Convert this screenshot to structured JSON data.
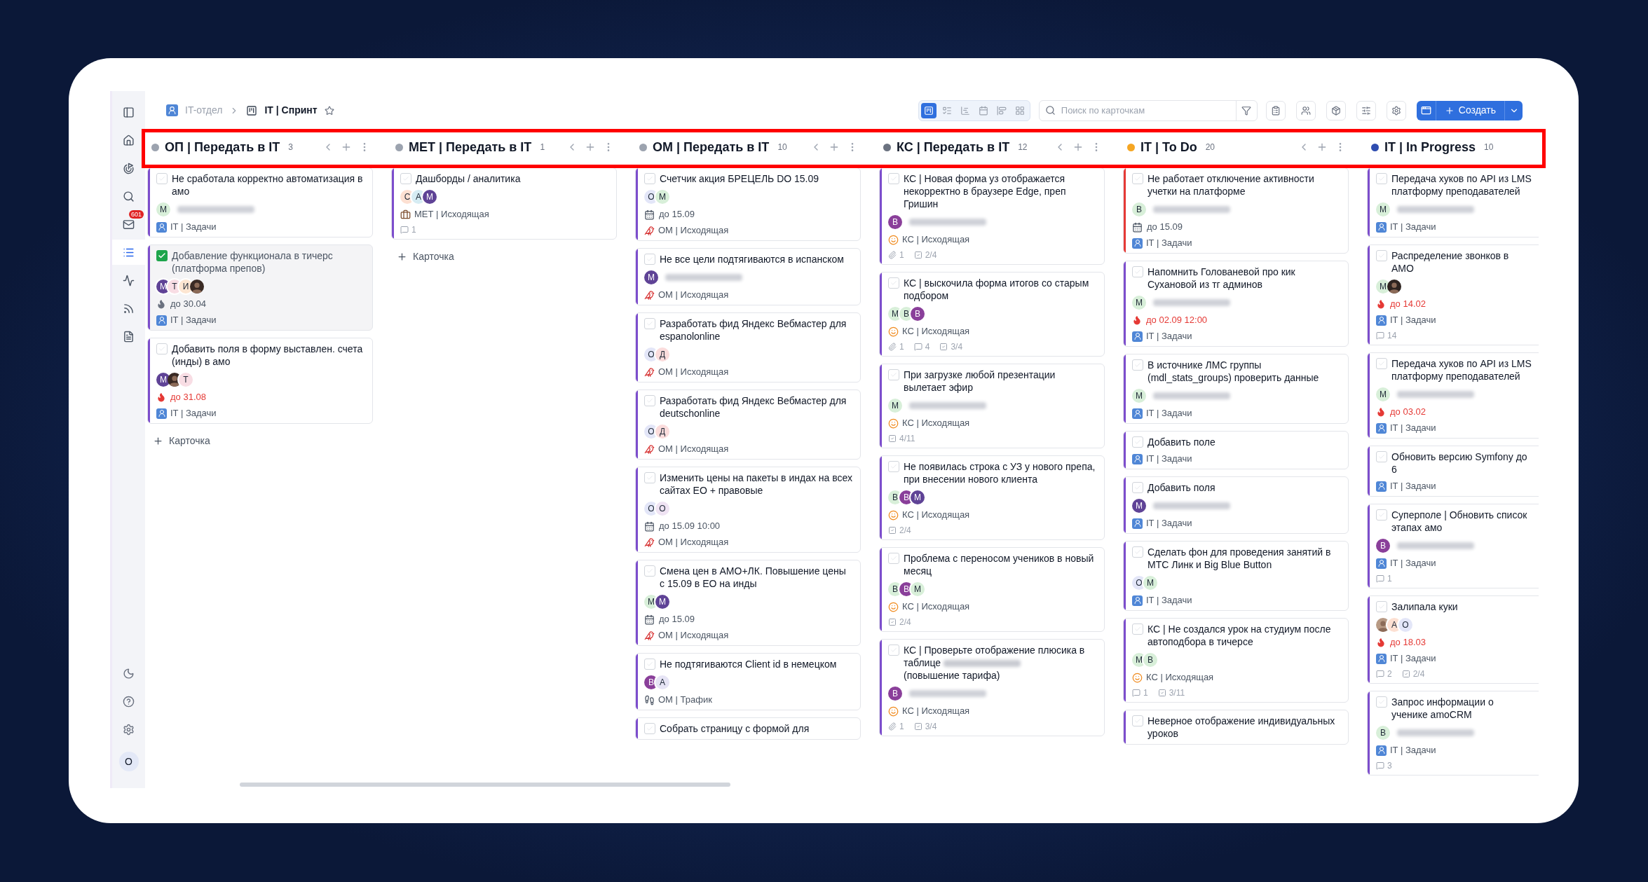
{
  "sidebar": {
    "items": [
      {
        "kind": "panel",
        "selected": false
      },
      {
        "kind": "home",
        "selected": false
      },
      {
        "kind": "goal",
        "selected": false
      },
      {
        "kind": "search",
        "selected": false
      },
      {
        "kind": "mail",
        "selected": false,
        "badge": "601"
      },
      {
        "kind": "list",
        "selected": true
      },
      {
        "kind": "activity",
        "selected": false
      },
      {
        "kind": "feed",
        "selected": false
      },
      {
        "kind": "document",
        "selected": false
      }
    ],
    "bottom": [
      {
        "kind": "theme"
      },
      {
        "kind": "help"
      },
      {
        "kind": "settings"
      }
    ],
    "user": {
      "letter": "О"
    }
  },
  "breadcrumb": {
    "parent": "IT-отдел",
    "current": "IT | Спринт",
    "starred": false
  },
  "views": [
    {
      "kind": "board",
      "selected": true
    },
    {
      "kind": "list",
      "selected": false
    },
    {
      "kind": "gantt",
      "selected": false
    },
    {
      "kind": "calendar",
      "selected": false
    },
    {
      "kind": "timeline",
      "selected": false
    },
    {
      "kind": "grid",
      "selected": false
    }
  ],
  "search": {
    "placeholder": "Поиск по карточкам"
  },
  "tools": [
    {
      "kind": "clipboard"
    },
    {
      "kind": "users"
    },
    {
      "kind": "bag"
    },
    {
      "kind": "sliders"
    },
    {
      "kind": "settings"
    }
  ],
  "create_button": {
    "label": "Создать"
  },
  "columns": [
    {
      "title": "ОП | Передать в IT",
      "count": "3",
      "color": "#9ca3af",
      "controls": true,
      "add_label": "Карточка",
      "cards": [
        {
          "title": "Не сработала корректно автоматизация в амо",
          "done": false,
          "color": "#7c4dcc",
          "avatars": [
            {
              "letter": "М",
              "color": "#d8efd9"
            }
          ],
          "name_hidden": true,
          "project": {
            "kind": "it",
            "text": "IT | Задачи"
          }
        },
        {
          "title": "Добавление функционала в тичерс (платформа препов)",
          "done": true,
          "color": "#7c4dcc",
          "avatars": [
            {
              "letter": "М",
              "color": "#5f4396"
            },
            {
              "letter": "Т",
              "color": "#f8dde4"
            },
            {
              "letter": "И",
              "color": "#fde6d2"
            },
            {
              "kind": "photo",
              "color": "#3a2a24"
            }
          ],
          "due": {
            "kind": "flame",
            "text": "до 30.04",
            "overdue": false
          },
          "project": {
            "kind": "it",
            "text": "IT | Задачи"
          }
        },
        {
          "title": "Добавить поля в форму выставлен. счета (инды) в амо",
          "done": false,
          "color": "#7c4dcc",
          "avatars": [
            {
              "letter": "М",
              "color": "#5f4396"
            },
            {
              "kind": "photo",
              "color": "#3a2a24"
            },
            {
              "letter": "Т",
              "color": "#f8dde4"
            }
          ],
          "due": {
            "kind": "flame",
            "text": "до 31.08",
            "overdue": true
          },
          "project": {
            "kind": "it",
            "text": "IT | Задачи"
          }
        }
      ]
    },
    {
      "title": "МЕТ | Передать в IT",
      "count": "1",
      "color": "#9ca3af",
      "controls": true,
      "add_label": "Карточка",
      "cards": [
        {
          "title": "Дашборды / аналитика",
          "done": false,
          "color": "#7c4dcc",
          "avatars": [
            {
              "letter": "С",
              "color": "#fde0d2"
            },
            {
              "letter": "А",
              "color": "#d6ecf3"
            },
            {
              "letter": "М",
              "color": "#5f4396"
            }
          ],
          "project": {
            "kind": "met",
            "text": "МЕТ | Исходящая"
          },
          "comments": "1"
        }
      ]
    },
    {
      "title": "ОМ | Передать в IT",
      "count": "10",
      "color": "#9ca3af",
      "controls": true,
      "cards": [
        {
          "title": "Счетчик акция БРЕЦЕЛЬ DO 15.09",
          "done": false,
          "color": "#7c4dcc",
          "avatars": [
            {
              "letter": "О",
              "color": "#e3e6f8"
            },
            {
              "letter": "М",
              "color": "#d8efd9"
            }
          ],
          "due": {
            "kind": "calendar",
            "text": "до 15.09",
            "overdue": false
          },
          "project": {
            "kind": "om",
            "text": "ОМ | Исходящая"
          }
        },
        {
          "title": "Не все цели подтягиваются в испанском",
          "done": false,
          "color": "#7c4dcc",
          "avatars": [
            {
              "letter": "М",
              "color": "#5f4396"
            }
          ],
          "name_hidden": true,
          "project": {
            "kind": "om",
            "text": "ОМ | Исходящая"
          }
        },
        {
          "title": "Разработать фид Яндекс Вебмастер для espanolonline",
          "done": false,
          "color": "#7c4dcc",
          "avatars": [
            {
              "letter": "О",
              "color": "#e3e6f8"
            },
            {
              "letter": "Д",
              "color": "#fbdcdc"
            }
          ],
          "project": {
            "kind": "om",
            "text": "ОМ | Исходящая"
          }
        },
        {
          "title": "Разработать фид Яндекс Вебмастер для deutschonline",
          "done": false,
          "color": "#7c4dcc",
          "avatars": [
            {
              "letter": "О",
              "color": "#e3e6f8"
            },
            {
              "letter": "Д",
              "color": "#fbdcdc"
            }
          ],
          "project": {
            "kind": "om",
            "text": "ОМ | Исходящая"
          }
        },
        {
          "title": "Изменить цены на пакеты в индах на всех сайтах ЕО + правовые",
          "done": false,
          "color": "#7c4dcc",
          "avatars": [
            {
              "letter": "О",
              "color": "#e3e6f8"
            },
            {
              "letter": "О",
              "color": "#efe3f3"
            }
          ],
          "due": {
            "kind": "calendar",
            "text": "до 15.09 10:00",
            "overdue": false
          },
          "project": {
            "kind": "om",
            "text": "ОМ | Исходящая"
          }
        },
        {
          "title": "Смена цен в АМО+ЛК. Повышение цены с 15.09 в ЕО на инды",
          "done": false,
          "color": "#7c4dcc",
          "avatars": [
            {
              "letter": "М",
              "color": "#d8efd9"
            },
            {
              "letter": "М",
              "color": "#5f4396"
            }
          ],
          "due": {
            "kind": "calendar",
            "text": "до 15.09",
            "overdue": false
          },
          "project": {
            "kind": "om",
            "text": "ОМ | Исходящая"
          }
        },
        {
          "title": "Не подтягиваются Client id в немецком",
          "done": false,
          "color": "#7c4dcc",
          "avatars": [
            {
              "letter": "В",
              "color": "#8a3f9a"
            },
            {
              "letter": "А",
              "color": "#e6e4f5"
            }
          ],
          "project": {
            "kind": "traffic",
            "text": "ОМ | Трафик"
          }
        },
        {
          "title": "Собрать страницу с формой для",
          "done": false,
          "color": "#7c4dcc"
        }
      ]
    },
    {
      "title": "КС | Передать в IT",
      "count": "12",
      "color": "#6b7280",
      "controls": true,
      "cards": [
        {
          "title": "КС | Новая форма уз отображается некорректно в браузере Edge, преп Гришин",
          "done": false,
          "color": "#7c4dcc",
          "avatars": [
            {
              "letter": "В",
              "color": "#8a3f9a"
            }
          ],
          "name_hidden": true,
          "project": {
            "kind": "kc",
            "text": "КС | Исходящая"
          },
          "attachments": "1",
          "checklist": "2/4"
        },
        {
          "title": "КС | выскочила форма итогов со старым подбором",
          "done": false,
          "color": "#7c4dcc",
          "avatars": [
            {
              "letter": "М",
              "color": "#d8efd9"
            },
            {
              "letter": "В",
              "color": "#d8efd9"
            },
            {
              "letter": "В",
              "color": "#8a3f9a"
            }
          ],
          "project": {
            "kind": "kc",
            "text": "КС | Исходящая"
          },
          "attachments": "1",
          "comments": "4",
          "checklist": "3/4"
        },
        {
          "title": "При загрузке любой презентации вылетает эфир",
          "done": false,
          "color": "#7c4dcc",
          "avatars": [
            {
              "letter": "М",
              "color": "#d8efd9"
            }
          ],
          "name_hidden": true,
          "project": {
            "kind": "kc",
            "text": "КС | Исходящая"
          },
          "checklist": "4/11"
        },
        {
          "title": "Не появилась строка с УЗ у нового препа, при внесении нового клиента",
          "done": false,
          "color": "#7c4dcc",
          "avatars": [
            {
              "letter": "В",
              "color": "#d8efd9"
            },
            {
              "letter": "В",
              "color": "#8a3f9a"
            },
            {
              "letter": "М",
              "color": "#5f4396"
            }
          ],
          "project": {
            "kind": "kc",
            "text": "КС | Исходящая"
          },
          "checklist": "2/4"
        },
        {
          "title": "Проблема с переносом учеников в новый месяц",
          "done": false,
          "color": "#7c4dcc",
          "avatars": [
            {
              "letter": "В",
              "color": "#d8efd9"
            },
            {
              "letter": "В",
              "color": "#8a3f9a"
            },
            {
              "letter": "М",
              "color": "#d8efd9"
            }
          ],
          "project": {
            "kind": "kc",
            "text": "КС | Исходящая"
          },
          "checklist": "2/4"
        },
        {
          "title": "КС | Проверьте отображение плюсика в таблице",
          "title_hidden_part": true,
          "title_rest": "(повышение тарифа)",
          "done": false,
          "color": "#7c4dcc",
          "avatars": [
            {
              "letter": "В",
              "color": "#8a3f9a"
            }
          ],
          "name_hidden": true,
          "project": {
            "kind": "kc",
            "text": "КС | Исходящая"
          },
          "attachments": "1",
          "checklist": "3/4"
        }
      ]
    },
    {
      "title": "IT | To Do",
      "count": "20",
      "color": "#f5a623",
      "controls": true,
      "cards": [
        {
          "title": "Не работает отключение активности учетки на платформе",
          "done": false,
          "color": "#e53935",
          "avatars": [
            {
              "letter": "В",
              "color": "#d8efd9"
            }
          ],
          "name_hidden": true,
          "due": {
            "kind": "calendar",
            "text": "до 15.09",
            "overdue": false
          },
          "project": {
            "kind": "it",
            "text": "IT | Задачи"
          }
        },
        {
          "title": "Напомнить Голованевой про кик Сухановой из тг админов",
          "done": false,
          "color": "#7c4dcc",
          "avatars": [
            {
              "letter": "М",
              "color": "#d8efd9"
            }
          ],
          "name_hidden": true,
          "due": {
            "kind": "flame",
            "text": "до 02.09 12:00",
            "overdue": true
          },
          "project": {
            "kind": "it",
            "text": "IT | Задачи"
          }
        },
        {
          "title": "В источнике ЛМС группы (mdl_stats_groups) проверить данные",
          "done": false,
          "color": "#7c4dcc",
          "avatars": [
            {
              "letter": "М",
              "color": "#d8efd9"
            }
          ],
          "name_hidden": true,
          "project": {
            "kind": "it",
            "text": "IT | Задачи"
          }
        },
        {
          "title": "Добавить поле",
          "done": false,
          "color": "#7c4dcc",
          "project": {
            "kind": "it",
            "text": "IT | Задачи"
          }
        },
        {
          "title": "Добавить поля",
          "done": false,
          "color": "#7c4dcc",
          "avatars": [
            {
              "letter": "М",
              "color": "#5f4396"
            }
          ],
          "name_hidden": true,
          "project": {
            "kind": "it",
            "text": "IT | Задачи"
          }
        },
        {
          "title": "Сделать фон для проведения занятий в МТС Линк и Big Blue Button",
          "done": false,
          "color": "#7c4dcc",
          "avatars": [
            {
              "letter": "О",
              "color": "#e3e6f8"
            },
            {
              "letter": "М",
              "color": "#d8efd9"
            }
          ],
          "project": {
            "kind": "it",
            "text": "IT | Задачи"
          }
        },
        {
          "title": "КС | Не создался урок на студиум после автоподбора в тичерсе",
          "done": false,
          "color": "#7c4dcc",
          "avatars": [
            {
              "letter": "М",
              "color": "#d8efd9"
            },
            {
              "letter": "В",
              "color": "#d8efd9"
            }
          ],
          "project": {
            "kind": "kc",
            "text": "КС | Исходящая"
          },
          "comments": "1",
          "checklist": "3/11"
        },
        {
          "title": "Неверное отображение индивидуальных уроков",
          "done": false,
          "color": "#7c4dcc"
        }
      ]
    },
    {
      "title": "IT | In Progress",
      "count": "10",
      "color": "#2f4db0",
      "controls": false,
      "cards": [
        {
          "title": "Передача хуков по API из LMS платформу преподавателей",
          "done": false,
          "color": "#7c4dcc",
          "avatars": [
            {
              "letter": "М",
              "color": "#d8efd9"
            }
          ],
          "name_hidden": true,
          "project": {
            "kind": "it",
            "text": "IT | Задачи"
          }
        },
        {
          "title": "Распределение звонков в АМО",
          "done": false,
          "color": "#7c4dcc",
          "avatars": [
            {
              "letter": "М",
              "color": "#d8efd9"
            },
            {
              "kind": "photo",
              "color": "#2e2420"
            }
          ],
          "due": {
            "kind": "flame",
            "text": "до 14.02",
            "overdue": true
          },
          "project": {
            "kind": "it",
            "text": "IT | Задачи"
          },
          "comments": "14"
        },
        {
          "title": "Передача хуков по API из LMS платформу преподавателей",
          "done": false,
          "color": "#7c4dcc",
          "avatars": [
            {
              "letter": "М",
              "color": "#d8efd9"
            }
          ],
          "name_hidden": true,
          "due": {
            "kind": "flame",
            "text": "до 03.02",
            "overdue": true
          },
          "project": {
            "kind": "it",
            "text": "IT | Задачи"
          }
        },
        {
          "title": "Обновить версию Symfony до 6",
          "done": false,
          "color": "#7c4dcc",
          "project": {
            "kind": "it",
            "text": "IT | Задачи"
          }
        },
        {
          "title": "Суперполе | Обновить список этапах амо",
          "done": false,
          "color": "#7c4dcc",
          "avatars": [
            {
              "letter": "В",
              "color": "#8a3f9a"
            }
          ],
          "name_hidden": true,
          "project": {
            "kind": "it",
            "text": "IT | Задачи"
          },
          "comments": "1"
        },
        {
          "title": "Залипала куки",
          "done": false,
          "color": "#7c4dcc",
          "avatars": [
            {
              "kind": "photo",
              "color": "#b89a84"
            },
            {
              "letter": "А",
              "color": "#fde0d2"
            },
            {
              "letter": "О",
              "color": "#e3e6f8"
            }
          ],
          "due": {
            "kind": "flame",
            "text": "до 18.03",
            "overdue": true
          },
          "project": {
            "kind": "it",
            "text": "IT | Задачи"
          },
          "comments": "2",
          "checklist": "2/4"
        },
        {
          "title": "Запрос информации о ученике amoCRM",
          "done": false,
          "color": "#7c4dcc",
          "avatars": [
            {
              "letter": "В",
              "color": "#d8efd9"
            }
          ],
          "name_hidden": true,
          "project": {
            "kind": "it",
            "text": "IT | Задачи"
          },
          "comments": "3"
        }
      ]
    }
  ]
}
